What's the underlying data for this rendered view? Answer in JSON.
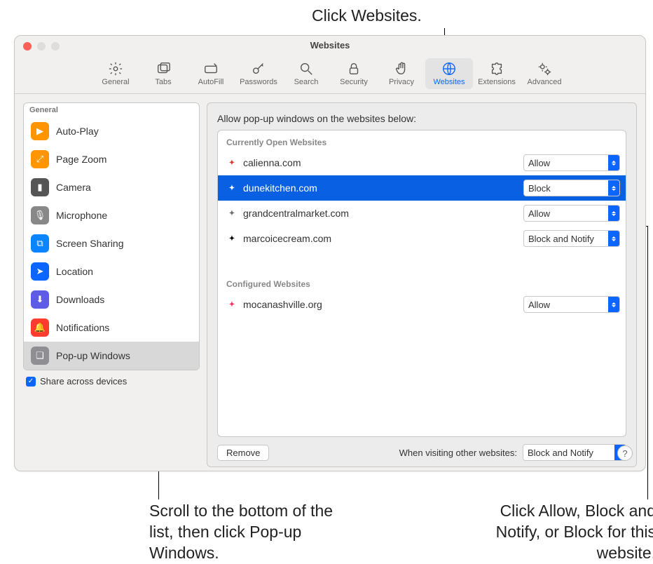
{
  "callouts": {
    "top": "Click Websites.",
    "bottom_left": "Scroll to the bottom of the list, then click Pop-up Windows.",
    "bottom_right": "Click Allow, Block and Notify, or Block for this website."
  },
  "window": {
    "title": "Websites"
  },
  "toolbar": [
    {
      "label": "General",
      "icon": "gear"
    },
    {
      "label": "Tabs",
      "icon": "tabs"
    },
    {
      "label": "AutoFill",
      "icon": "autofill"
    },
    {
      "label": "Passwords",
      "icon": "key"
    },
    {
      "label": "Search",
      "icon": "search"
    },
    {
      "label": "Security",
      "icon": "lock"
    },
    {
      "label": "Privacy",
      "icon": "hand"
    },
    {
      "label": "Websites",
      "icon": "globe",
      "selected": true
    },
    {
      "label": "Extensions",
      "icon": "puzzle"
    },
    {
      "label": "Advanced",
      "icon": "gears"
    }
  ],
  "sidebar": {
    "header": "General",
    "items": [
      {
        "label": "Auto-Play",
        "color": "#ff9500",
        "glyph": "▶"
      },
      {
        "label": "Page Zoom",
        "color": "#ff9500",
        "glyph": "⤢"
      },
      {
        "label": "Camera",
        "color": "#555",
        "glyph": "▮"
      },
      {
        "label": "Microphone",
        "color": "#888",
        "glyph": "🎙"
      },
      {
        "label": "Screen Sharing",
        "color": "#0a84ff",
        "glyph": "⧉"
      },
      {
        "label": "Location",
        "color": "#0a66ff",
        "glyph": "➤"
      },
      {
        "label": "Downloads",
        "color": "#5e5ce6",
        "glyph": "⬇"
      },
      {
        "label": "Notifications",
        "color": "#ff3b30",
        "glyph": "🔔"
      },
      {
        "label": "Pop-up Windows",
        "color": "#8e8e93",
        "glyph": "❏",
        "selected": true
      }
    ]
  },
  "share_checkbox": {
    "label": "Share across devices",
    "checked": true
  },
  "main": {
    "prompt": "Allow pop-up windows on the websites below:",
    "group_open": "Currently Open Websites",
    "group_conf": "Configured Websites",
    "open_sites": [
      {
        "name": "calienna.com",
        "value": "Allow",
        "fav": "#d43a2f"
      },
      {
        "name": "dunekitchen.com",
        "value": "Block",
        "fav": "#fff",
        "selected": true
      },
      {
        "name": "grandcentralmarket.com",
        "value": "Allow",
        "fav": "#6b6b6b"
      },
      {
        "name": "marcoicecream.com",
        "value": "Block and Notify",
        "fav": "#000"
      }
    ],
    "conf_sites": [
      {
        "name": "mocanashville.org",
        "value": "Allow",
        "fav": "#ff2d55"
      }
    ],
    "remove_label": "Remove",
    "other_label": "When visiting other websites:",
    "other_value": "Block and Notify"
  },
  "help": "?"
}
